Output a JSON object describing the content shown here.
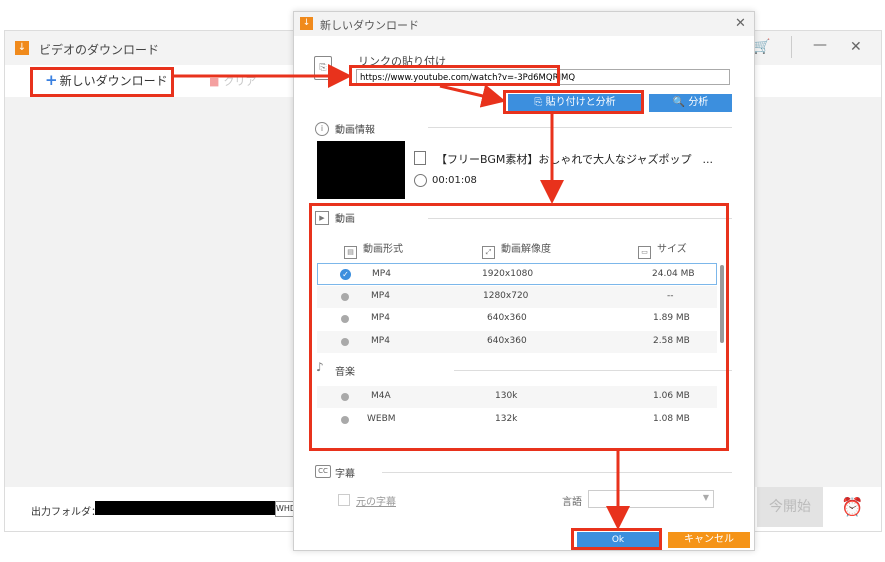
{
  "app": {
    "title": "ビデオのダウンロード",
    "new_download": "新しいダウンロード",
    "clear": "クリア",
    "output_folder_label": "出力フォルダ：",
    "output_path_tail": "WHD V",
    "start_button": "今開始"
  },
  "dialog": {
    "title": "新しいダウンロード",
    "link_label": "リンクの貼り付け",
    "url_value": "https://www.youtube.com/watch?v=-3Pd6MQRJMQ",
    "paste_analyze_button": "貼り付けと分析",
    "analyze_button": "分析",
    "info_section": "動画情報",
    "video_title": "【フリーBGM素材】おしゃれで大人なジャズポップ　...",
    "duration": "00:01:08",
    "video_section": "動画",
    "columns": [
      "動画形式",
      "動画解像度",
      "サイズ"
    ],
    "video_rows": [
      {
        "format": "MP4",
        "resolution": "1920x1080",
        "size": "24.04 MB",
        "selected": true
      },
      {
        "format": "MP4",
        "resolution": "1280x720",
        "size": "--",
        "selected": false
      },
      {
        "format": "MP4",
        "resolution": "640x360",
        "size": "1.89 MB",
        "selected": false
      },
      {
        "format": "MP4",
        "resolution": "640x360",
        "size": "2.58 MB",
        "selected": false
      }
    ],
    "audio_section": "音楽",
    "audio_rows": [
      {
        "format": "M4A",
        "bitrate": "130k",
        "size": "1.06 MB"
      },
      {
        "format": "WEBM",
        "bitrate": "132k",
        "size": "1.08 MB"
      }
    ],
    "subtitle_section": "字幕",
    "original_subtitle": "元の字幕",
    "language_label": "言語",
    "ok_button": "Ok",
    "cancel_button": "キャンセル"
  },
  "colors": {
    "accent_blue": "#3c8fde",
    "cancel_orange": "#f59418",
    "annotation_red": "#e8321c"
  }
}
